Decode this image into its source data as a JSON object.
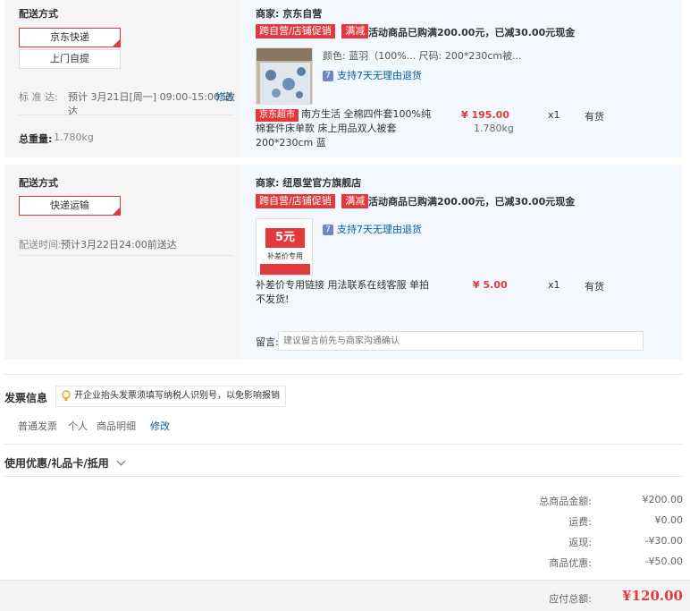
{
  "shop1": {
    "delivery_title": "配送方式",
    "opt1": "京东快递",
    "opt2": "上门自提",
    "std_label": "标 准 达:",
    "std_time": "预计 3月21日[周一] 09:00-15:00 送达",
    "edit": "修改",
    "weight_label": "总重量:",
    "weight": "1.780kg",
    "merchant": "商家: 京东自营",
    "tag1": "跨自营/店铺促销",
    "tag2": "满减",
    "promo": "活动商品已购满200.00元，已减30.00元现金",
    "spec": "颜色: 蓝羽（100%...  尺码: 200*230cm被...",
    "return_note": "支持7天无理由退货",
    "supermarket_tag": "京东超市",
    "title": "南方生活 全棉四件套100%纯棉套件床单款 床上用品双人被套200*230cm 蓝",
    "price": "¥ 195.00",
    "qty": "x1",
    "stock": "有货",
    "item_weight": "1.780kg"
  },
  "shop2": {
    "delivery_title": "配送方式",
    "opt1": "快递运输",
    "time_label": "配送时间:",
    "time": "预计3月22日24:00前送达",
    "merchant": "商家: 纽恩堂官方旗舰店",
    "tag1": "跨自营/店铺促销",
    "tag2": "满减",
    "promo": "活动商品已购满200.00元，已减30.00元现金",
    "return_note": "支持7天无理由退货",
    "thumb_big": "5元",
    "thumb_sub": "补差价专用",
    "title": "补差价专用链接 用法联系在线客服 单拍不发货!",
    "price": "¥ 5.00",
    "qty": "x1",
    "stock": "有货",
    "msg_label": "留言:",
    "msg_placeholder": "建议留言前先与商家沟通确认"
  },
  "invoice": {
    "title": "发票信息",
    "tip": "开企业抬头发票须填写纳税人识别号，以免影响报销",
    "type": "普通发票",
    "head": "个人",
    "content": "商品明细",
    "edit": "修改"
  },
  "coupon": {
    "title": "使用优惠/礼品卡/抵用"
  },
  "summary": {
    "rows": [
      {
        "label": "总商品金额:",
        "value": "¥200.00"
      },
      {
        "label": "运费:",
        "value": "¥0.00"
      },
      {
        "label": "返现:",
        "value": "-¥30.00"
      },
      {
        "label": "商品优惠:",
        "value": "-¥50.00"
      }
    ],
    "total_label": "应付总额:",
    "total": "¥120.00"
  }
}
